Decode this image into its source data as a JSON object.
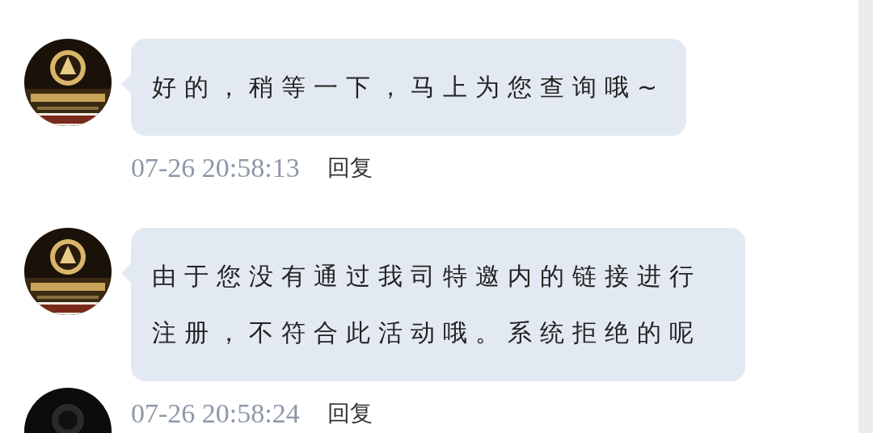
{
  "messages": [
    {
      "text": "好的，稍等一下，马上为您查询哦~",
      "time": "07-26 20:58:13",
      "reply": "回复"
    },
    {
      "text": "由于您没有通过我司特邀内的链接进行注册，不符合此活动哦。系统拒绝的呢",
      "time": "07-26 20:58:24",
      "reply": "回复"
    }
  ]
}
